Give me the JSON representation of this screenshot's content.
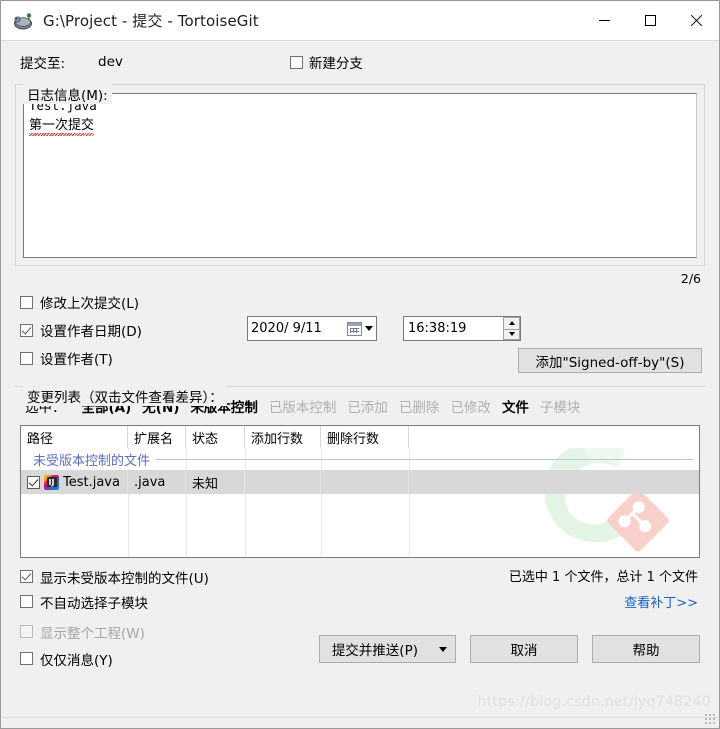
{
  "window": {
    "title": "G:\\Project - 提交 - TortoiseGit",
    "icon": "tortoisegit-icon",
    "minimize": "minimize-icon",
    "maximize": "maximize-icon",
    "close": "close-icon"
  },
  "commit_to": {
    "label": "提交至:",
    "branch": "dev",
    "new_branch_label": "新建分支",
    "new_branch_checked": false
  },
  "log_message": {
    "group_title": "日志信息(M):",
    "line1": "Test.java",
    "line2": "第一次提交",
    "counter": "2/6"
  },
  "options": {
    "amend_label": "修改上次提交(L)",
    "amend_checked": false,
    "set_author_date_label": "设置作者日期(D)",
    "set_author_date_checked": true,
    "set_author_label": "设置作者(T)",
    "set_author_checked": false,
    "date_value": "2020/ 9/11",
    "date_icon": "calendar-icon",
    "date_dropdown_icon": "chevron-down-icon",
    "time_value": "16:38:19",
    "spin_up_icon": "spin-up-icon",
    "spin_down_icon": "spin-down-icon",
    "signed_off_button": "添加\"Signed-off-by\"(S)"
  },
  "changelist": {
    "group_title": "变更列表（双击文件查看差异）：",
    "select_label": "选中：",
    "filters": [
      {
        "label": "全部(A)",
        "enabled": true
      },
      {
        "label": "无(N)",
        "enabled": true
      },
      {
        "label": "未版本控制",
        "enabled": true
      },
      {
        "label": "已版本控制",
        "enabled": false
      },
      {
        "label": "已添加",
        "enabled": false
      },
      {
        "label": "已删除",
        "enabled": false
      },
      {
        "label": "已修改",
        "enabled": false
      },
      {
        "label": "文件",
        "enabled": true
      },
      {
        "label": "子模块",
        "enabled": false
      }
    ],
    "columns": [
      "路径",
      "扩展名",
      "状态",
      "添加行数",
      "删除行数"
    ],
    "group_row": "未受版本控制的文件",
    "rows": [
      {
        "checked": true,
        "icon": "intellij-java-file-icon",
        "path": "Test.java",
        "extension": ".java",
        "status": "未知",
        "added_lines": "",
        "deleted_lines": ""
      }
    ],
    "watermark_icon": "tortoisegit-watermark-logo"
  },
  "below_list": {
    "show_unversioned_label": "显示未受版本控制的文件(U)",
    "show_unversioned_checked": true,
    "no_auto_submodule_label": "不自动选择子模块",
    "no_auto_submodule_checked": false,
    "status_text": "已选中 1 个文件，总计 1 个文件",
    "patch_link": "查看补丁>>"
  },
  "footer": {
    "show_whole_project_label": "显示整个工程(W)",
    "show_whole_project_checked": false,
    "show_whole_project_disabled": true,
    "message_only_label": "仅仅消息(Y)",
    "message_only_checked": false,
    "commit_push_label": "提交并推送(P)",
    "commit_push_dropdown_icon": "chevron-down-icon",
    "cancel_label": "取消",
    "help_label": "帮助"
  },
  "watermark_url": "https://blog.csdn.net/lyq748240",
  "colors": {
    "window_bg": "#f0f0f0",
    "title_bg": "#ffffff",
    "link": "#1b60c4",
    "group_row_text": "#5a6fc0",
    "selected_row": "#d8d8d8",
    "disabled_text": "#b0b0b0"
  }
}
